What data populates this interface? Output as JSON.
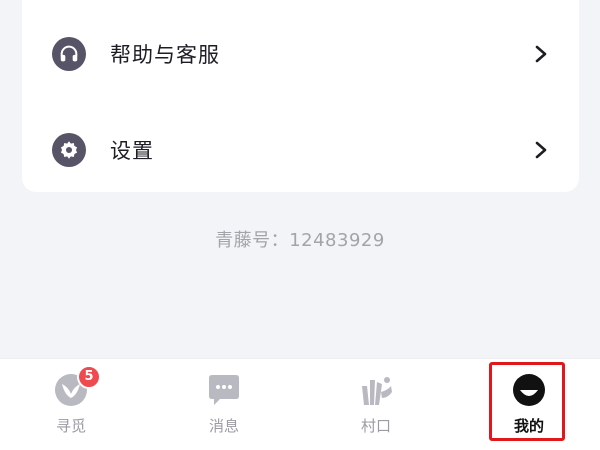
{
  "menu": {
    "items": [
      {
        "label": "帮助与客服",
        "icon": "headset-icon"
      },
      {
        "label": "设置",
        "icon": "gear-icon"
      }
    ]
  },
  "account": {
    "id_label": "青藤号：",
    "id_value": "12483929"
  },
  "tabbar": {
    "tabs": [
      {
        "label": "寻觅",
        "icon": "explore-leaf-icon",
        "badge": "5"
      },
      {
        "label": "消息",
        "icon": "chat-bubble-icon"
      },
      {
        "label": "村口",
        "icon": "village-icon"
      },
      {
        "label": "我的",
        "icon": "profile-face-icon",
        "active": true
      }
    ]
  },
  "colors": {
    "background": "#f3f4f7",
    "icon_bg": "#565466",
    "badge": "#ee4a4f",
    "highlight": "#e0181e"
  }
}
